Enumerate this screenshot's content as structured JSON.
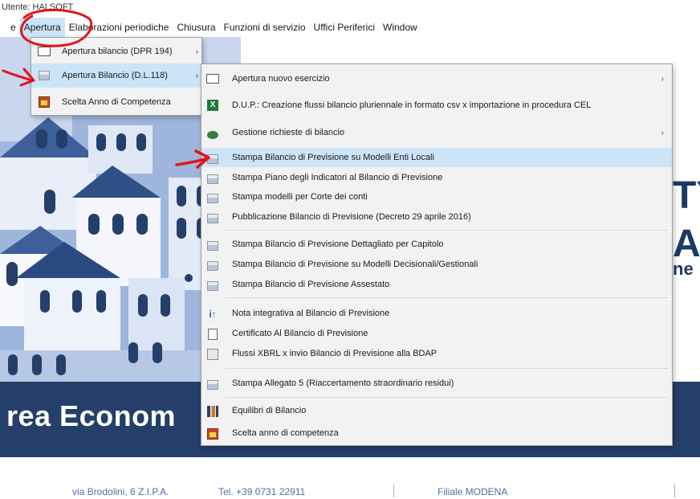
{
  "window": {
    "title": "Utente: HALSOFT"
  },
  "menubar": {
    "items": [
      {
        "label": "File",
        "visible": "e"
      },
      {
        "label": "Apertura"
      },
      {
        "label": "Elaborazioni periodiche"
      },
      {
        "label": "Chiusura"
      },
      {
        "label": "Funzioni di servizio"
      },
      {
        "label": "Uffici Periferici"
      },
      {
        "label": "Window"
      }
    ]
  },
  "submenu1": {
    "items": [
      {
        "label": "Apertura bilancio (DPR 194)",
        "icon": "open-form-icon",
        "has_submenu": true
      },
      {
        "label": "Apertura Bilancio (D.L.118)",
        "icon": "printer-icon",
        "has_submenu": true
      },
      {
        "label": "Scelta Anno di Competenza",
        "icon": "calendar-icon",
        "has_submenu": false
      }
    ]
  },
  "submenu2": {
    "items": [
      {
        "label": "Apertura nuovo esercizio",
        "icon": "open-form-icon",
        "has_submenu": true
      },
      {
        "label": "D.U.P.: Creazione flussi bilancio pluriennale in formato csv x importazione in procedura CEL",
        "icon": "excel-icon",
        "has_submenu": false
      },
      {
        "label": "Gestione richieste di bilancio",
        "icon": "leaf-icon",
        "has_submenu": true
      },
      {
        "label": "Stampa Bilancio di Previsione su Modelli Enti Locali",
        "icon": "printer-icon",
        "has_submenu": false
      },
      {
        "label": "Stampa Piano degli Indicatori al Bilancio di Previsione",
        "icon": "printer-icon",
        "has_submenu": false
      },
      {
        "label": "Stampa modelli per Corte dei conti",
        "icon": "printer-icon",
        "has_submenu": false
      },
      {
        "label": "Pubblicazione Bilancio di Previsione (Decreto 29 aprile 2016)",
        "icon": "printer-icon",
        "has_submenu": false
      },
      {
        "label": "Stampa Bilancio di Previsione Dettagliato per Capitolo",
        "icon": "printer-icon",
        "has_submenu": false
      },
      {
        "label": "Stampa Bilancio di Previsione su Modelli Decisionali/Gestionali",
        "icon": "printer-icon",
        "has_submenu": false
      },
      {
        "label": "Stampa Bilancio di Previsione Assestato",
        "icon": "printer-icon",
        "has_submenu": false
      },
      {
        "label": "Nota integrativa al Bilancio di Previsione",
        "icon": "nota-icon",
        "has_submenu": false
      },
      {
        "label": "Certificato Al Bilancio di Previsione",
        "icon": "document-icon",
        "has_submenu": false
      },
      {
        "label": "Flussi XBRL x invio Bilancio di Previsione alla BDAP",
        "icon": "grid-icon",
        "has_submenu": false
      },
      {
        "label": "Stampa Allegato 5 (Riaccertamento straordinario residui)",
        "icon": "printer-icon",
        "has_submenu": false
      },
      {
        "label": "Equilibri di Bilancio",
        "icon": "chart-icon",
        "has_submenu": false
      },
      {
        "label": "Scelta anno di competenza",
        "icon": "calendar-icon",
        "has_submenu": false
      }
    ]
  },
  "background": {
    "band_title": "rea Econom",
    "brand_fragments": [
      "TY",
      "AR",
      "ne"
    ],
    "footer": {
      "address": "via Brodolini, 6 Z.I.P.A.",
      "phone": "Tel. +39 0731 22911",
      "branch": "Filiale MODENA"
    }
  },
  "colors": {
    "menu_bg": "#f2f2f2",
    "highlight": "#cce4f7",
    "band": "#253f6b",
    "annotation": "#e0141b"
  }
}
